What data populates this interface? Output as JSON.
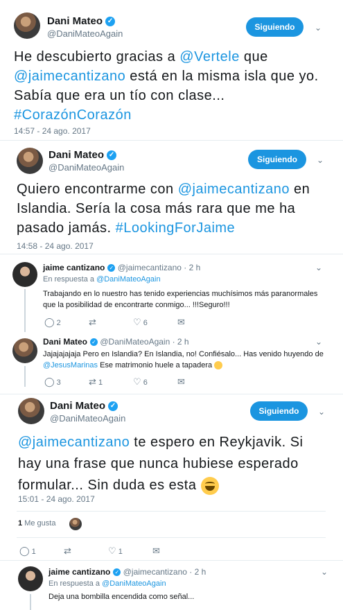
{
  "tweet1": {
    "name": "Dani Mateo",
    "handle": "@DaniMateoAgain",
    "follow_label": "Siguiendo",
    "text_parts": [
      "He descubierto gracias a ",
      "@Vertele",
      " que ",
      "@jaimecantizano",
      " está en la misma isla que yo. Sabía que era un tío con clase... ",
      "#CorazónCorazón"
    ],
    "timestamp": "14:57 - 24 ago. 2017"
  },
  "tweet2": {
    "name": "Dani Mateo",
    "handle": "@DaniMateoAgain",
    "follow_label": "Siguiendo",
    "text_parts": [
      "Quiero encontrarme con ",
      "@jaimecantizano",
      " en Islandia. Sería la cosa más rara que me ha pasado jamás. ",
      "#LookingForJaime"
    ],
    "timestamp": "14:58 - 24 ago. 2017"
  },
  "reply1": {
    "name": "jaime cantizano",
    "handle": "@jaimecantizano · 2 h",
    "reply_prefix": "En respuesta a ",
    "reply_to": "@DaniMateoAgain",
    "text": "Trabajando en lo nuestro has tenido experiencias muchísimos más paranormales que la posibilidad de encontrarte conmigo... !!!Seguro!!!",
    "replies": "2",
    "retweets": "",
    "likes": "6"
  },
  "reply2": {
    "name": "Dani Mateo",
    "handle": "@DaniMateoAgain · 2 h",
    "text_parts": [
      "Jajajajajaja Pero en Islandia? En Islandia, no! Confiésalo... Has venido huyendo de ",
      "@JesusMarinas",
      " Ese matrimonio huele a tapadera"
    ],
    "replies": "3",
    "retweets": "1",
    "likes": "6"
  },
  "tweet3": {
    "name": "Dani Mateo",
    "handle": "@DaniMateoAgain",
    "follow_label": "Siguiendo",
    "text_parts": [
      "@jaimecantizano",
      " te espero en Reykjavik. Si hay una frase que nunca hubiese esperado formular... Sin duda es esta"
    ],
    "timestamp": "15:01 - 24 ago. 2017",
    "likes_count": "1",
    "likes_label": "Me gusta",
    "replies": "1",
    "retweets": "",
    "likes": "1"
  },
  "reply3": {
    "name": "jaime cantizano",
    "handle": "@jaimecantizano · 2 h",
    "reply_prefix": "En respuesta a ",
    "reply_to": "@DaniMateoAgain",
    "text": "Deja una bombilla encendida como señal..."
  },
  "colors": {
    "accent": "#1b95e0",
    "muted": "#657786",
    "border": "#e6ecf0"
  },
  "icons": [
    "verified-icon",
    "chevron-down-icon",
    "reply-icon",
    "retweet-icon",
    "like-icon",
    "message-icon"
  ]
}
